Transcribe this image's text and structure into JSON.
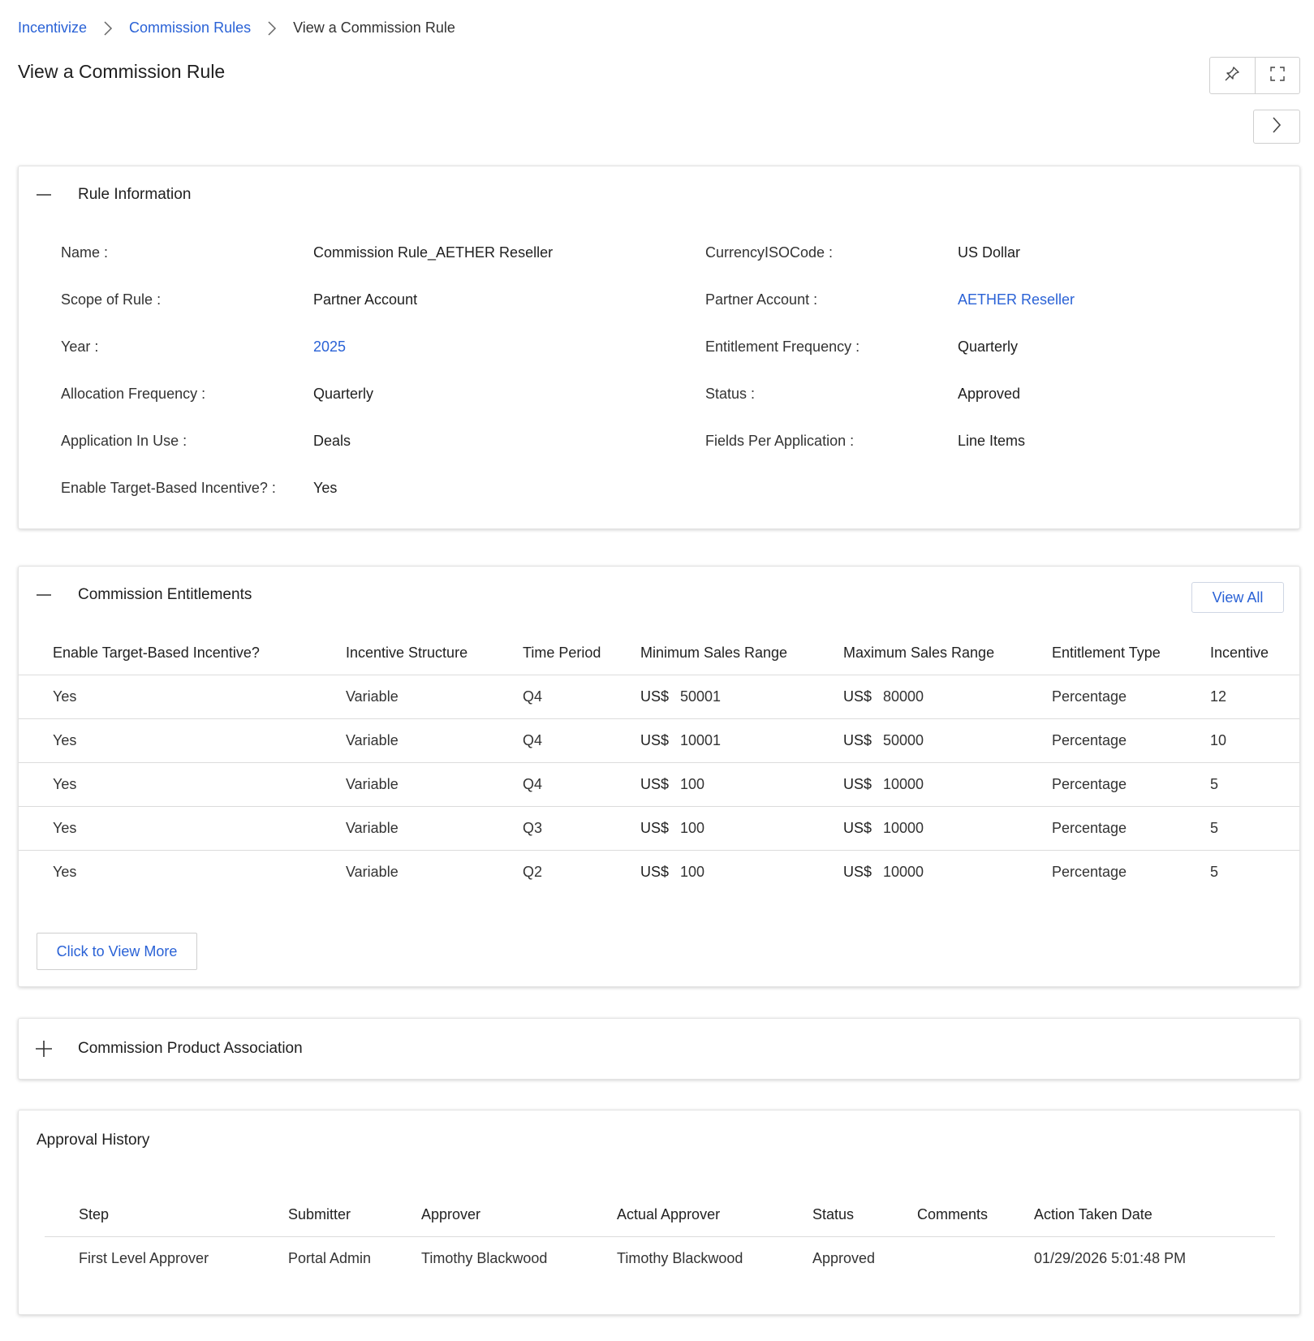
{
  "breadcrumb": {
    "items": [
      "Incentivize",
      "Commission Rules"
    ],
    "current": "View a Commission Rule"
  },
  "page": {
    "title": "View a Commission Rule"
  },
  "toolbar": {
    "icons": [
      "pin-icon",
      "expand-icon",
      "chevron-right-icon"
    ]
  },
  "rule_information": {
    "title": "Rule Information",
    "fields": {
      "name": {
        "label": "Name :",
        "value": "Commission Rule_AETHER Reseller"
      },
      "currency": {
        "label": "CurrencyISOCode :",
        "value": "US Dollar"
      },
      "scope": {
        "label": "Scope of Rule :",
        "value": "Partner Account"
      },
      "partner_account": {
        "label": "Partner Account :",
        "value": "AETHER Reseller"
      },
      "year": {
        "label": "Year :",
        "value": "2025"
      },
      "entitlement_frequency": {
        "label": "Entitlement Frequency :",
        "value": "Quarterly"
      },
      "allocation_frequency": {
        "label": "Allocation Frequency :",
        "value": "Quarterly"
      },
      "status": {
        "label": "Status :",
        "value": "Approved"
      },
      "application_in_use": {
        "label": "Application In Use :",
        "value": "Deals"
      },
      "fields_per_application": {
        "label": "Fields Per Application :",
        "value": "Line Items"
      },
      "target_based": {
        "label": "Enable Target-Based Incentive? :",
        "value": "Yes"
      }
    }
  },
  "entitlements": {
    "title": "Commission Entitlements",
    "view_all_label": "View All",
    "more_label": "Click to View More",
    "columns": [
      "Enable Target-Based Incentive?",
      "Incentive Structure",
      "Time Period",
      "Minimum Sales Range",
      "Maximum Sales Range",
      "Entitlement Type",
      "Incentive"
    ],
    "currency_prefix": "US$",
    "rows": [
      {
        "target": "Yes",
        "structure": "Variable",
        "period": "Q4",
        "min": "50001",
        "max": "80000",
        "type": "Percentage",
        "incentive": "12"
      },
      {
        "target": "Yes",
        "structure": "Variable",
        "period": "Q4",
        "min": "10001",
        "max": "50000",
        "type": "Percentage",
        "incentive": "10"
      },
      {
        "target": "Yes",
        "structure": "Variable",
        "period": "Q4",
        "min": "100",
        "max": "10000",
        "type": "Percentage",
        "incentive": "5"
      },
      {
        "target": "Yes",
        "structure": "Variable",
        "period": "Q3",
        "min": "100",
        "max": "10000",
        "type": "Percentage",
        "incentive": "5"
      },
      {
        "target": "Yes",
        "structure": "Variable",
        "period": "Q2",
        "min": "100",
        "max": "10000",
        "type": "Percentage",
        "incentive": "5"
      }
    ]
  },
  "product_association": {
    "title": "Commission Product Association"
  },
  "approval_history": {
    "title": "Approval History",
    "columns": [
      "Step",
      "Submitter",
      "Approver",
      "Actual Approver",
      "Status",
      "Comments",
      "Action Taken Date"
    ],
    "rows": [
      {
        "step": "First Level Approver",
        "submitter": "Portal Admin",
        "approver": "Timothy Blackwood",
        "actual_approver": "Timothy Blackwood",
        "status": "Approved",
        "comments": "",
        "date": "01/29/2026 5:01:48 PM"
      }
    ]
  },
  "colors": {
    "link": "#2a62d6",
    "border": "#dcdcdc",
    "text": "#222222"
  }
}
